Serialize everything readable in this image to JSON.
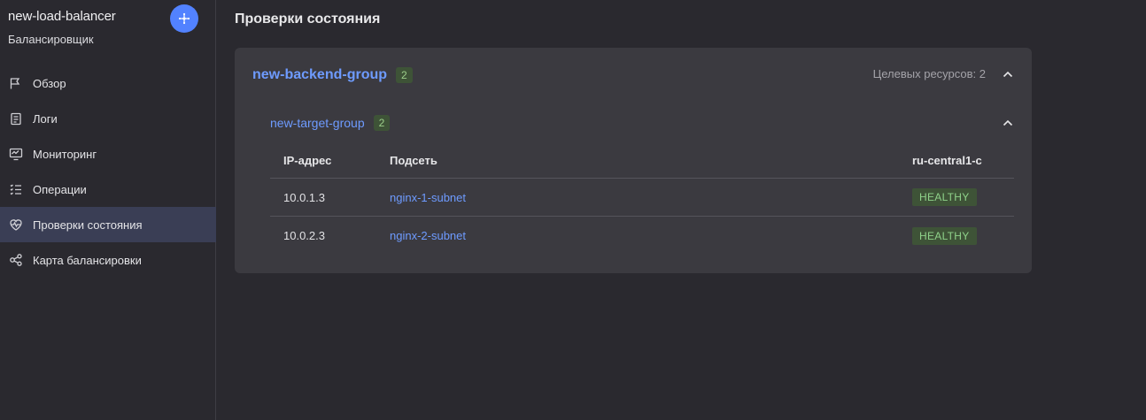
{
  "sidebar": {
    "title": "new-load-balancer",
    "subtitle": "Балансировщик",
    "avatar_icon": "network-icon",
    "items": [
      {
        "label": "Обзор",
        "icon": "flag-icon"
      },
      {
        "label": "Логи",
        "icon": "log-icon"
      },
      {
        "label": "Мониторинг",
        "icon": "monitor-icon"
      },
      {
        "label": "Операции",
        "icon": "list-check-icon"
      },
      {
        "label": "Проверки состояния",
        "icon": "heartbeat-icon",
        "active": true
      },
      {
        "label": "Карта балансировки",
        "icon": "nodes-icon"
      }
    ]
  },
  "main": {
    "title": "Проверки состояния",
    "backend_group": {
      "name": "new-backend-group",
      "count": "2",
      "targets_label": "Целевых ресурсов: 2",
      "target_group": {
        "name": "new-target-group",
        "count": "2",
        "columns": {
          "ip": "IP-адрес",
          "subnet": "Подсеть",
          "zone": "ru-central1-c"
        },
        "rows": [
          {
            "ip": "10.0.1.3",
            "subnet": "nginx-1-subnet",
            "status": "HEALTHY"
          },
          {
            "ip": "10.0.2.3",
            "subnet": "nginx-2-subnet",
            "status": "HEALTHY"
          }
        ]
      }
    }
  },
  "colors": {
    "accent": "#5282ff",
    "link": "#6e9bff",
    "healthy_text": "#8fd28a",
    "healthy_bg": "#3e5337",
    "active_nav": "#3a3e55"
  }
}
